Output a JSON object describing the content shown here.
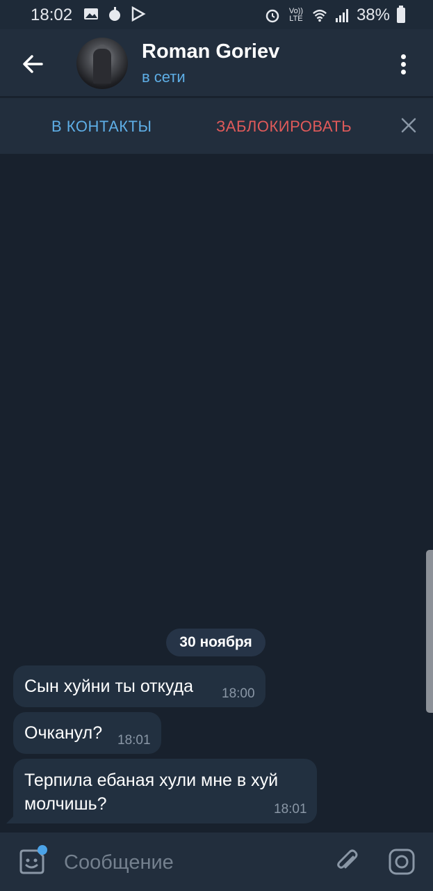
{
  "status_bar": {
    "time": "18:02",
    "battery": "38%",
    "volte": "Vo)) LTE",
    "left_icons": [
      "image-icon",
      "notification-dot-icon",
      "play-store-icon"
    ],
    "right_icons": [
      "alarm-icon",
      "wifi-icon",
      "signal-icon",
      "battery-icon"
    ]
  },
  "header": {
    "name": "Roman Goriev",
    "status": "в сети"
  },
  "action_bar": {
    "add_contact": "В КОНТАКТЫ",
    "block": "ЗАБЛОКИРОВАТЬ"
  },
  "chat": {
    "date": "30 ноября",
    "messages": [
      {
        "text": "Сын хуйни ты откуда",
        "time": "18:00"
      },
      {
        "text": "Очканул?",
        "time": "18:01"
      },
      {
        "text": "Терпила ебаная хули мне в хуй молчишь?",
        "time": "18:01"
      }
    ]
  },
  "input": {
    "placeholder": "Сообщение"
  },
  "colors": {
    "background": "#18212d",
    "panel": "#222e3d",
    "accent": "#5eaee6",
    "danger": "#e05a5a",
    "bubble": "#223040"
  }
}
